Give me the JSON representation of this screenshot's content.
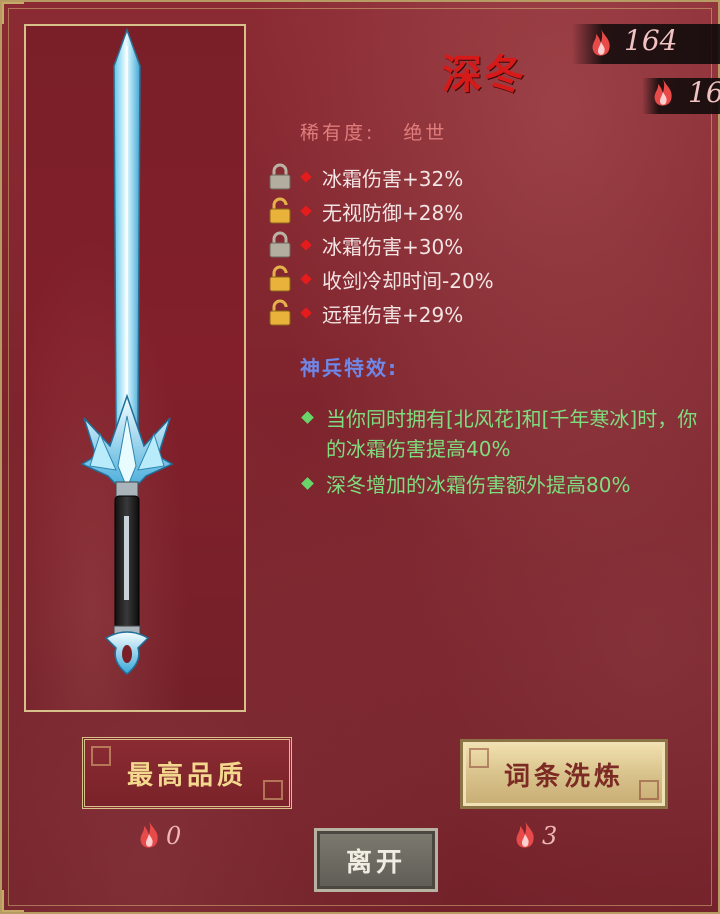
{
  "weapon": {
    "name": "深冬",
    "rarity_label": "稀有度:",
    "rarity_value": "绝世"
  },
  "currency": {
    "primary_value": "164",
    "secondary_value": "16"
  },
  "stats": [
    {
      "label": "冰霜伤害+32%",
      "locked": true
    },
    {
      "label": "无视防御+28%",
      "locked": false
    },
    {
      "label": "冰霜伤害+30%",
      "locked": true
    },
    {
      "label": "收剑冷却时间-20%",
      "locked": false
    },
    {
      "label": "远程伤害+29%",
      "locked": false
    }
  ],
  "special": {
    "title": "神兵特效:",
    "effects": [
      "当你同时拥有[北风花]和[千年寒冰]时，你的冰霜伤害提高40%",
      "深冬增加的冰霜伤害额外提高80%"
    ]
  },
  "buttons": {
    "max_quality": "最高品质",
    "reroll": "词条洗炼",
    "leave": "离开"
  },
  "costs": {
    "max_quality": "0",
    "reroll": "3"
  },
  "colors": {
    "panel": "#7c232c",
    "title_red": "#d61a1a",
    "effect_green": "#7fdd7f",
    "section_blue": "#6f88e8",
    "gold_border": "#d8c08a"
  },
  "icons": {
    "weapon": "ice-sword-icon",
    "currency": "red-flame-icon",
    "lock": "padlock-icon"
  }
}
